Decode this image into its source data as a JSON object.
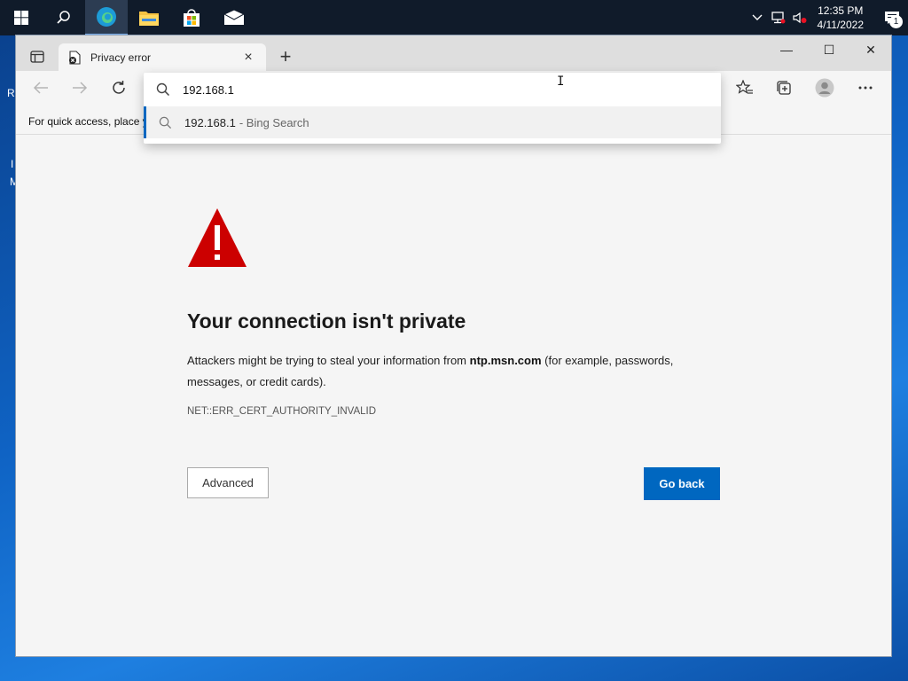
{
  "taskbar": {
    "clock": {
      "time": "12:35 PM",
      "date": "4/11/2022"
    },
    "notification_count": "1"
  },
  "desktop": {
    "stray_labels": [
      "R",
      "I",
      "M"
    ]
  },
  "browser": {
    "tab": {
      "title": "Privacy error",
      "close": "×"
    },
    "new_tab": "+",
    "window_controls": {
      "minimize": "—",
      "maximize": "☐",
      "close": "✕"
    },
    "favorites_bar_text": "For quick access, place y",
    "omnibox": {
      "value": "192.168.1",
      "suggestion": {
        "text": "192.168.1",
        "source": "- Bing Search"
      }
    }
  },
  "error_page": {
    "title": "Your connection isn't private",
    "desc_before": "Attackers might be trying to steal your information from ",
    "domain": "ntp.msn.com",
    "desc_after": " (for example, passwords, messages, or credit cards).",
    "code": "NET::ERR_CERT_AUTHORITY_INVALID",
    "advanced_label": "Advanced",
    "go_back_label": "Go back"
  },
  "colors": {
    "accent": "#0067c0",
    "warning": "#cc0000",
    "taskbar": "#101b2a"
  }
}
